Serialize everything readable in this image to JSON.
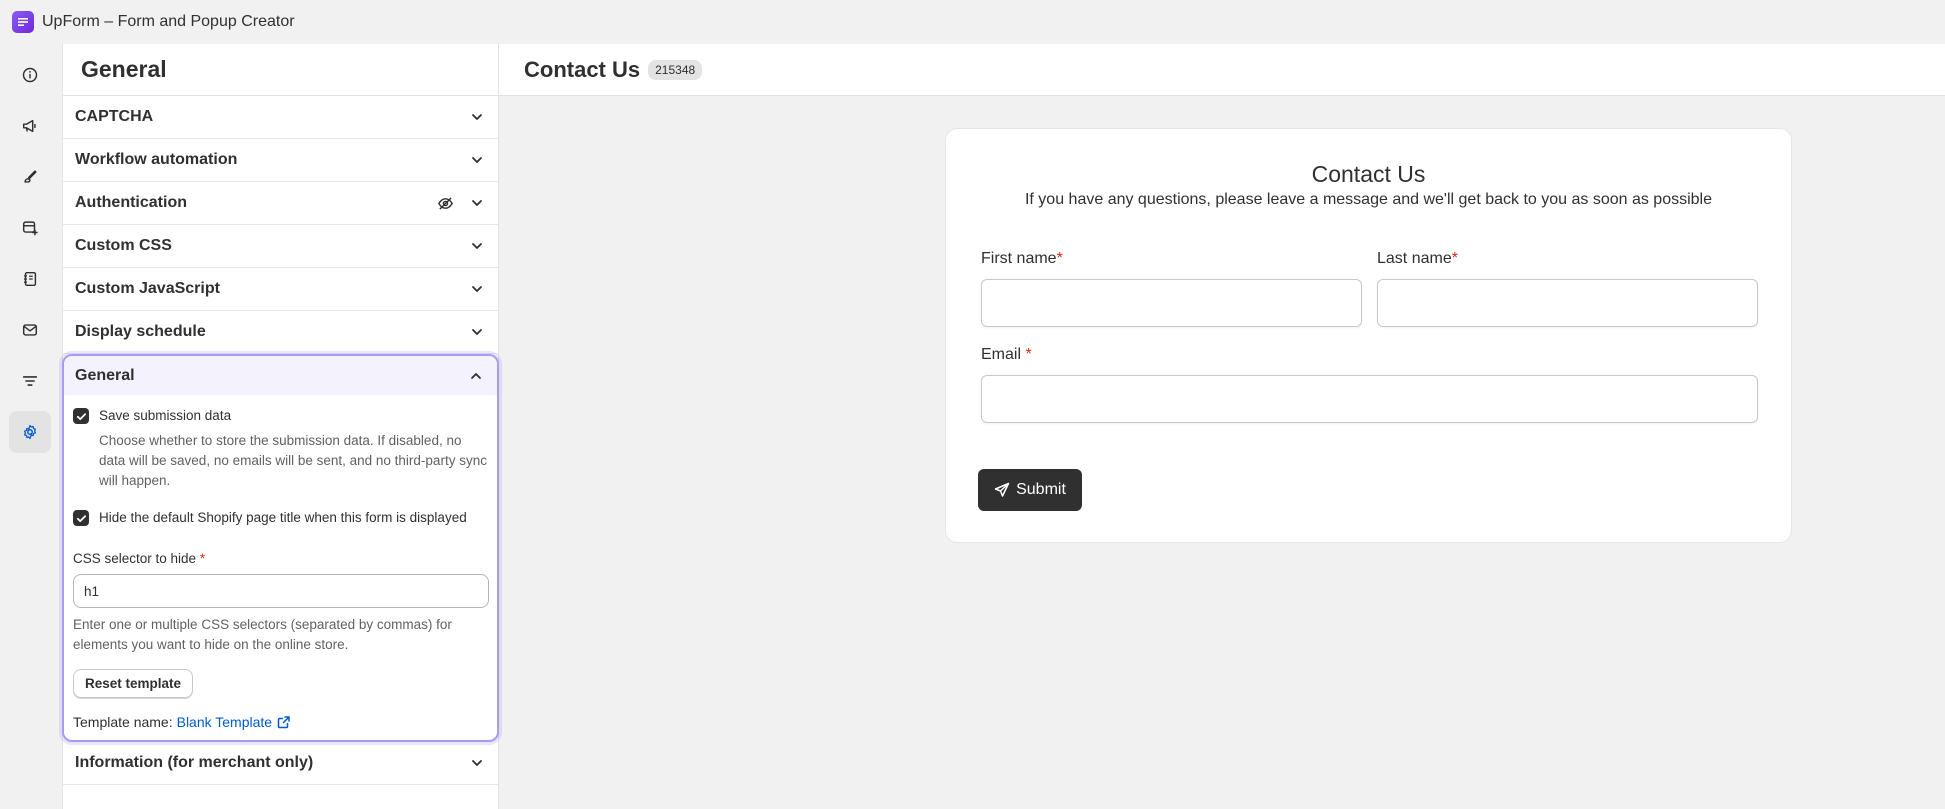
{
  "app": {
    "title": "UpForm – Form and Popup Creator"
  },
  "rail": {
    "items": [
      {
        "icon": "info-icon"
      },
      {
        "icon": "megaphone-icon"
      },
      {
        "icon": "brush-icon"
      },
      {
        "icon": "add-block-icon"
      },
      {
        "icon": "notebook-icon"
      },
      {
        "icon": "mail-icon"
      },
      {
        "icon": "filter-icon"
      },
      {
        "icon": "gear-icon",
        "active": true
      }
    ]
  },
  "panel": {
    "title": "General",
    "sections": [
      {
        "label": "CAPTCHA"
      },
      {
        "label": "Workflow automation"
      },
      {
        "label": "Authentication"
      },
      {
        "label": "Custom CSS"
      },
      {
        "label": "Custom JavaScript"
      },
      {
        "label": "Display schedule"
      }
    ],
    "open_section": {
      "label": "General",
      "save_submission": {
        "label": "Save submission data",
        "checked": true,
        "help": "Choose whether to store the submission data. If disabled, no data will be saved, no emails will be sent, and no third-party sync will happen."
      },
      "hide_title": {
        "label": "Hide the default Shopify page title when this form is displayed",
        "checked": true
      },
      "css_selector": {
        "label": "CSS selector to hide",
        "required_mark": "*",
        "value": "h1",
        "help": "Enter one or multiple CSS selectors (separated by commas) for elements you want to hide on the online store."
      },
      "reset_label": "Reset template",
      "template_name_label": "Template name:",
      "template_name_value": "Blank Template"
    },
    "after_sections": [
      {
        "label": "Information (for merchant only)"
      }
    ]
  },
  "main": {
    "title": "Contact Us",
    "badge": "215348"
  },
  "form": {
    "title": "Contact Us",
    "subtitle": "If you have any questions, please leave a message and we'll get back to you as soon as possible",
    "first_name_label": "First name",
    "last_name_label": "Last name",
    "email_label": "Email",
    "required_mark": "*",
    "submit_label": "Submit"
  },
  "colors": {
    "accent_outline": "#a99bf2",
    "link": "#005bd3",
    "required": "#d72c0d",
    "button_dark": "#303030"
  }
}
